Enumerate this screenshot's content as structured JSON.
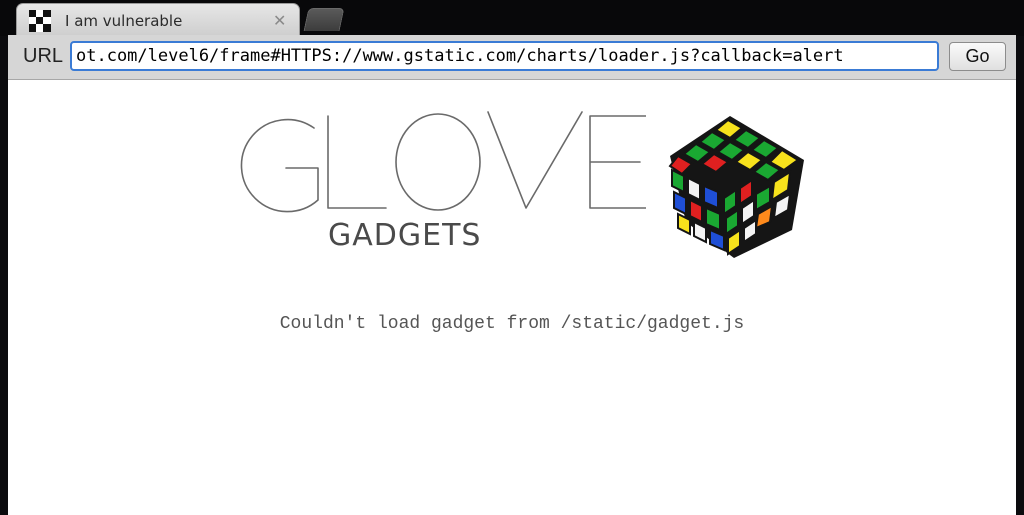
{
  "tab": {
    "title": "I am vulnerable",
    "close_glyph": "✕",
    "favicon": "checkered-favicon"
  },
  "toolbar": {
    "url_label": "URL",
    "url_value": "ot.com/level6/frame#HTTPS://www.gstatic.com/charts/loader.js?callback=alert",
    "go_label": "Go"
  },
  "page": {
    "logo_glove": "GLOVE",
    "logo_gadgets": "GADGETS",
    "message": "Couldn't load gadget from /static/gadget.js"
  },
  "colors": {
    "url_focus": "#3a7bd5",
    "cube_red": "#e02020",
    "cube_green": "#1aa832",
    "cube_blue": "#1f4fd6",
    "cube_yellow": "#f7e21c",
    "cube_orange": "#ff8a1c",
    "cube_white": "#f4f4f4"
  }
}
